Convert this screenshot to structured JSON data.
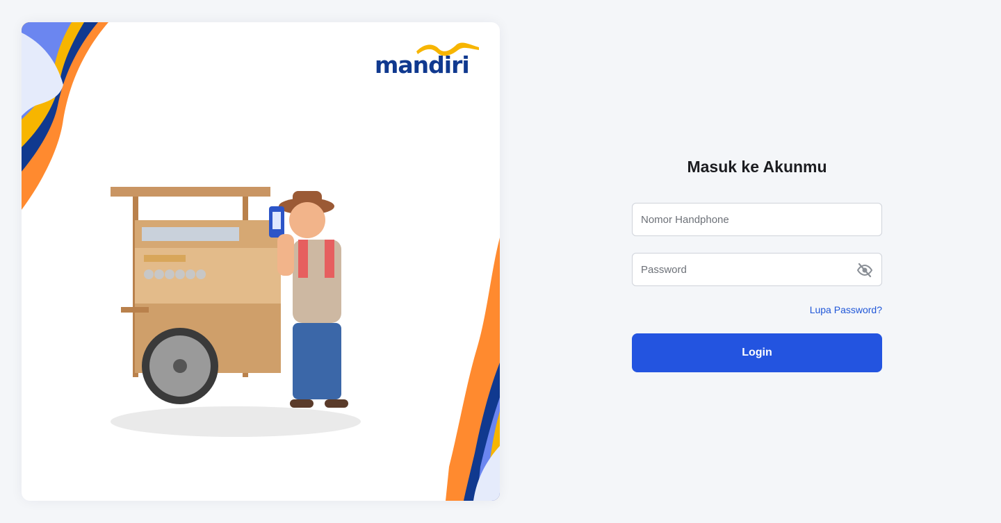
{
  "brand": {
    "logo_text": "mandiri",
    "primary_color": "#2354e0",
    "navy": "#10398f",
    "gold": "#f7b500",
    "orange": "#ff8a2f"
  },
  "hero": {
    "illustration": "street-vendor-with-phone-qris"
  },
  "login": {
    "title": "Masuk ke Akunmu",
    "phone_placeholder": "Nomor Handphone",
    "password_placeholder": "Password",
    "password_toggle_icon": "eye-off-icon",
    "forgot_password": "Lupa Password?",
    "submit_label": "Login"
  }
}
